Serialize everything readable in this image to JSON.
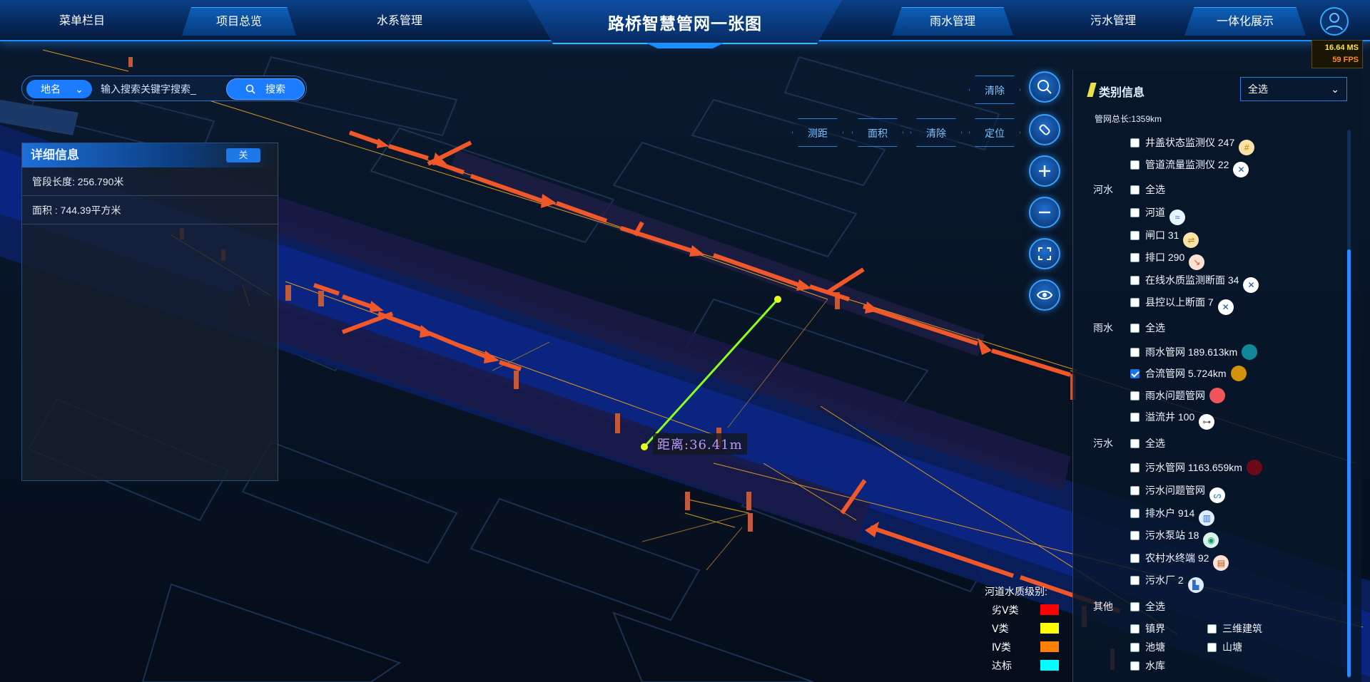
{
  "header": {
    "title": "路桥智慧管网一张图",
    "nav": [
      "菜单栏目",
      "项目总览",
      "水系管理",
      "雨水管理",
      "污水管理",
      "一体化展示"
    ],
    "fps_ms": "16.64 MS",
    "fps_fps": "59 FPS"
  },
  "search": {
    "type_label": "地名",
    "placeholder": "输入搜索关键字搜索_",
    "button": "搜索"
  },
  "detail": {
    "title": "详细信息",
    "close": "关",
    "rows": [
      "管段长度: 256.790米",
      "面积 : 744.39平方米"
    ]
  },
  "tools": {
    "clear_top": "清除",
    "measure": "测距",
    "area": "面积",
    "clear": "清除",
    "locate": "定位"
  },
  "map": {
    "distance_label": "距离:36.41m"
  },
  "category": {
    "title": "类别信息",
    "select_value": "全选",
    "total": "管网总长:1359km",
    "groups": [
      {
        "name": "",
        "items": [
          {
            "label": "井盖状态监测仪 247",
            "checked": false,
            "icon": "grid-icon",
            "color": "#ffffff"
          },
          {
            "label": "管道流量监测仪 22",
            "checked": false,
            "icon": "satellite-icon",
            "color": "#ffffff"
          }
        ]
      },
      {
        "name": "河水",
        "items": [
          {
            "label": "全选",
            "checked": false
          },
          {
            "label": "河道",
            "checked": false,
            "icon": "river-icon",
            "color": "#ffffff"
          },
          {
            "label": "闸口 31",
            "checked": false,
            "icon": "gate-icon",
            "color": "#ffffff"
          },
          {
            "label": "排口 290",
            "checked": false,
            "icon": "outlet-icon",
            "color": "#ffffff"
          },
          {
            "label": "在线水质监测断面 34",
            "checked": false,
            "icon": "satellite-icon",
            "color": "#ffffff"
          },
          {
            "label": "县控以上断面 7",
            "checked": false,
            "icon": "satellite-icon",
            "color": "#ffffff"
          }
        ]
      },
      {
        "name": "雨水",
        "items": [
          {
            "label": "全选",
            "checked": false
          },
          {
            "label": "雨水管网 189.613km",
            "checked": false,
            "icon": "dot",
            "color": "#11879c"
          },
          {
            "label": "合流管网 5.724km",
            "checked": true,
            "icon": "dot",
            "color": "#d4920a"
          },
          {
            "label": "雨水问题管网",
            "checked": false,
            "icon": "dot",
            "color": "#f0555a"
          },
          {
            "label": "溢流井 100",
            "checked": false,
            "icon": "key-icon",
            "color": "#ffffff"
          }
        ]
      },
      {
        "name": "污水",
        "items": [
          {
            "label": "全选",
            "checked": false
          },
          {
            "label": "污水管网 1163.659km",
            "checked": false,
            "icon": "dot",
            "color": "#6a0a1a"
          },
          {
            "label": "污水问题管网",
            "checked": false,
            "icon": "pipe-icon",
            "color": "#ffffff"
          },
          {
            "label": "排水户 914",
            "checked": false,
            "icon": "building-icon",
            "color": "#ffffff"
          },
          {
            "label": "污水泵站 18",
            "checked": false,
            "icon": "pump-icon",
            "color": "#ffffff"
          },
          {
            "label": "农村水终端 92",
            "checked": false,
            "icon": "tank-icon",
            "color": "#ffffff"
          },
          {
            "label": "污水厂 2",
            "checked": false,
            "icon": "factory-icon",
            "color": "#ffffff"
          }
        ]
      },
      {
        "name": "其他",
        "items": [
          {
            "label": "全选",
            "checked": false
          },
          {
            "label": "镇界",
            "checked": false
          },
          {
            "label": "三维建筑",
            "checked": false
          },
          {
            "label": "池塘",
            "checked": false
          },
          {
            "label": "山塘",
            "checked": false
          },
          {
            "label": "水库",
            "checked": false
          }
        ]
      }
    ]
  },
  "legend": {
    "title": "河道水质级别:",
    "rows": [
      {
        "label": "劣Ⅴ类",
        "color": "#ff0000"
      },
      {
        "label": "Ⅴ类",
        "color": "#ffff00"
      },
      {
        "label": "Ⅳ类",
        "color": "#ff8000"
      },
      {
        "label": "达标",
        "color": "#00ffff"
      }
    ]
  }
}
